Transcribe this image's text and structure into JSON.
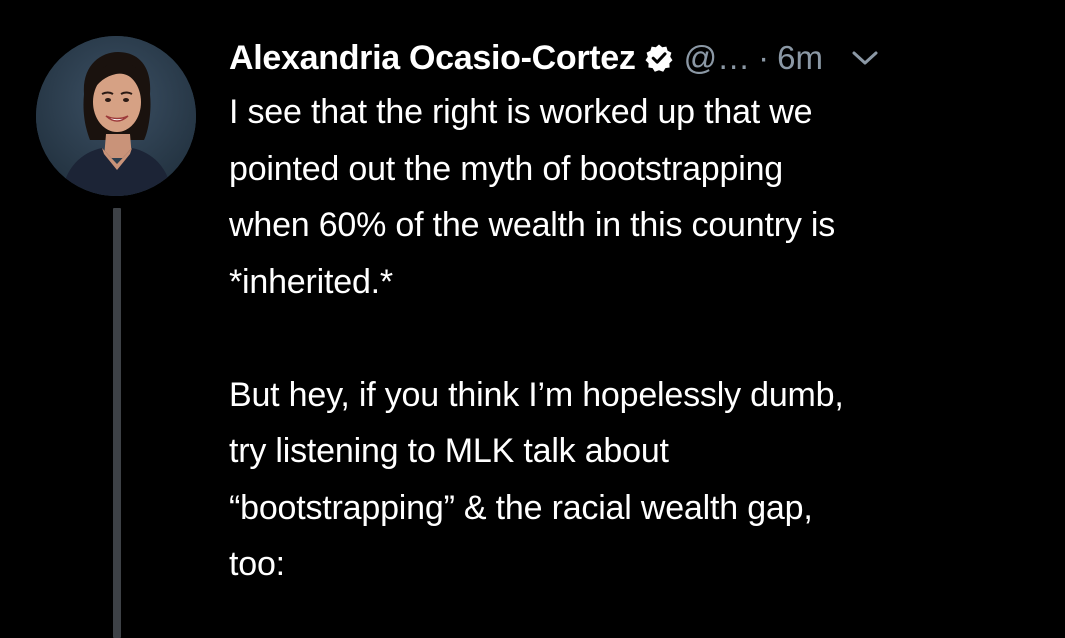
{
  "tweet": {
    "author": {
      "display_name": "Alexandria Ocasio-Cortez",
      "handle": "@…",
      "verified": true
    },
    "separator": "·",
    "timestamp": "6m",
    "paragraphs": [
      {
        "lines": [
          "I see that the right is worked up that we",
          "pointed out the myth of bootstrapping",
          "when 60% of the wealth in this country is",
          "*inherited.*"
        ]
      },
      {
        "lines": [
          "But hey, if you think I’m hopelessly dumb,",
          "try listening to MLK talk about",
          "“bootstrapping” & the racial wealth gap,",
          "too:"
        ]
      }
    ]
  },
  "colors": {
    "background": "#000000",
    "text_primary": "#ffffff",
    "text_secondary": "#8b98a5",
    "thread_line": "#3d4146"
  },
  "icons": {
    "verified": "verified-badge-icon",
    "menu": "chevron-down-icon"
  }
}
